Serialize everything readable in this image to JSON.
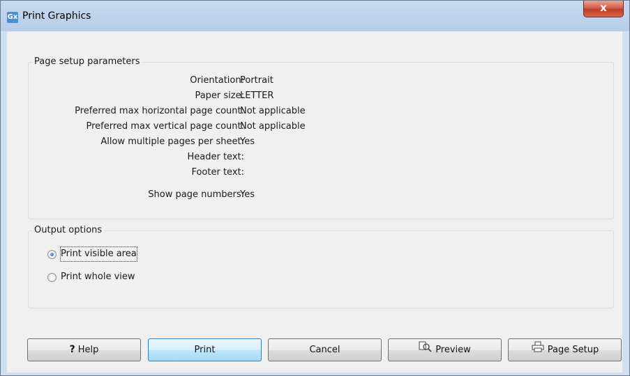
{
  "window": {
    "app_icon_text": "Gx",
    "title": "Print Graphics",
    "close_label": "x"
  },
  "page_setup": {
    "legend": "Page setup parameters",
    "rows": [
      {
        "label": "Orientation:",
        "value": "Portrait"
      },
      {
        "label": "Paper size:",
        "value": "LETTER"
      },
      {
        "label": "Preferred max horizontal page count:",
        "value": "Not applicable"
      },
      {
        "label": "Preferred max vertical page count:",
        "value": "Not applicable"
      },
      {
        "label": "Allow multiple pages per sheet:",
        "value": "Yes"
      },
      {
        "label": "Header text:",
        "value": ""
      },
      {
        "label": "Footer text:",
        "value": ""
      },
      {
        "label": "Show page numbers:",
        "value": "Yes"
      }
    ]
  },
  "output": {
    "legend": "Output options",
    "options": [
      {
        "label": "Print visible area",
        "selected": true
      },
      {
        "label": "Print whole view",
        "selected": false
      }
    ]
  },
  "buttons": {
    "help": "Help",
    "help_icon": "?",
    "print": "Print",
    "cancel": "Cancel",
    "preview": "Preview",
    "page_setup": "Page Setup"
  },
  "icons": {
    "app": "app-icon",
    "help": "question-mark-icon",
    "preview": "preview-icon",
    "page_setup": "page-setup-icon"
  }
}
